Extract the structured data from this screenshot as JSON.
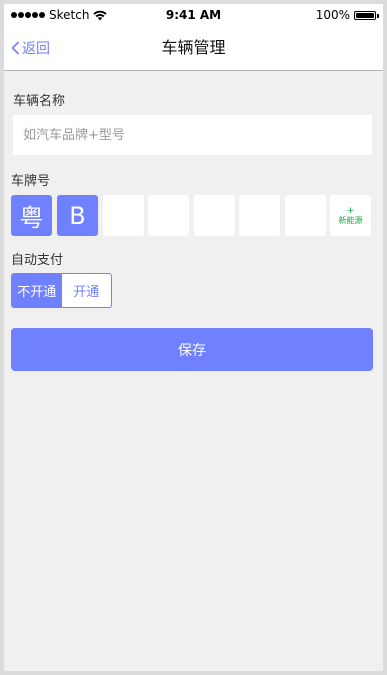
{
  "status_bar": {
    "carrier": "Sketch",
    "time": "9:41 AM",
    "battery_percent": "100%",
    "signal_bars": 5,
    "battery_level": 1.0
  },
  "nav": {
    "back_label": "返回",
    "title": "车辆管理"
  },
  "form": {
    "name_label": "车辆名称",
    "name_placeholder": "如汽车品牌+型号",
    "name_value": "",
    "plate_label": "车牌号",
    "plate_chars": [
      "粤",
      "B",
      "",
      "",
      "",
      "",
      ""
    ],
    "new_energy_plus": "+",
    "new_energy_label": "新能源",
    "autopay_label": "自动支付",
    "autopay_options": [
      "不开通",
      "开通"
    ],
    "autopay_selected": "不开通",
    "save_label": "保存"
  },
  "colors": {
    "accent": "#7081ff",
    "new_energy": "#1aaa3b",
    "background": "#f0f0f0"
  }
}
